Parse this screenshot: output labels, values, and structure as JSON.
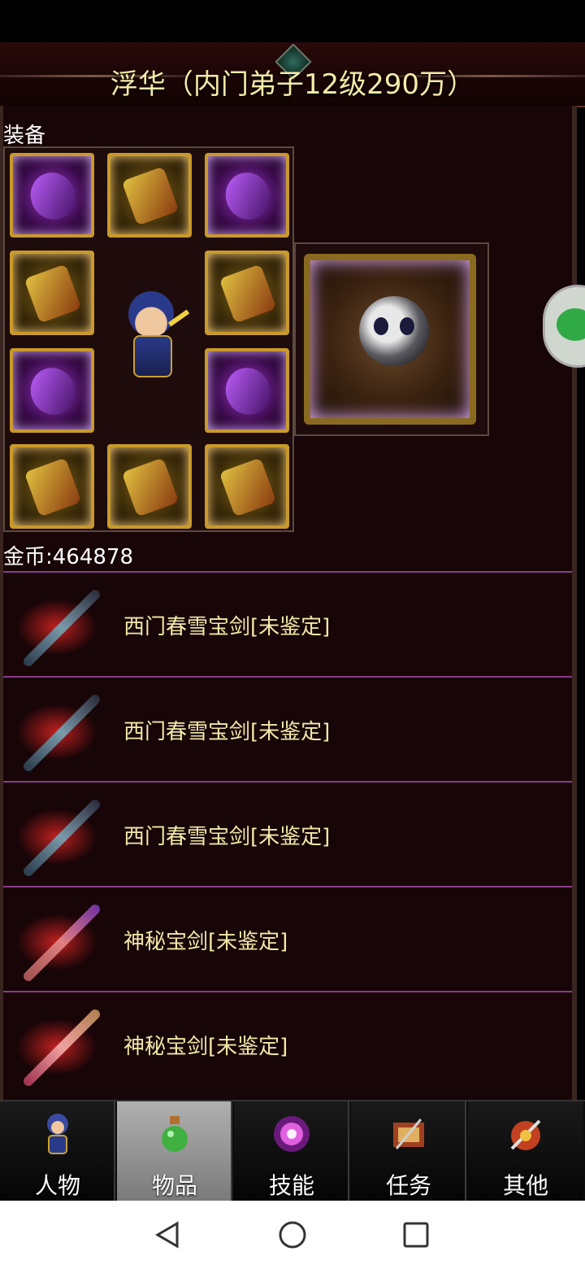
{
  "header": {
    "title": "浮华（内门弟子12级290万）"
  },
  "equipment": {
    "section_label": "装备",
    "slots": [
      {
        "icon": "helmet-icon",
        "style": "purple-frame"
      },
      {
        "icon": "wings-armor-icon",
        "style": "gold-frame"
      },
      {
        "icon": "necklace-icon",
        "style": "purple-frame"
      },
      {
        "icon": "sword-icon",
        "style": "gold-frame"
      },
      {
        "icon": "sword-icon",
        "style": "gold-frame"
      },
      {
        "icon": "gauntlet-icon",
        "style": "purple-frame"
      },
      {
        "icon": "gauntlet-icon",
        "style": "purple-frame"
      },
      {
        "icon": "boots-icon",
        "style": "gold-frame"
      },
      {
        "icon": "belt-icon",
        "style": "gold-frame"
      },
      {
        "icon": "ring-icon",
        "style": "gold-frame"
      }
    ]
  },
  "pet": {
    "icon": "panda-pet-icon"
  },
  "gold": {
    "label": "金币:464878"
  },
  "items": [
    {
      "name": "西门春雪宝剑[未鉴定]",
      "icon": "dark-sword-icon"
    },
    {
      "name": "西门春雪宝剑[未鉴定]",
      "icon": "dark-sword-icon"
    },
    {
      "name": "西门春雪宝剑[未鉴定]",
      "icon": "dark-sword-icon"
    },
    {
      "name": "神秘宝剑[未鉴定]",
      "icon": "violet-sword-icon"
    },
    {
      "name": "神秘宝剑[未鉴定]",
      "icon": "rose-sword-icon"
    }
  ],
  "nav": {
    "tabs": [
      {
        "label": "人物",
        "icon": "character-icon",
        "active": false
      },
      {
        "label": "物品",
        "icon": "potion-icon",
        "active": true
      },
      {
        "label": "技能",
        "icon": "skill-orb-icon",
        "active": false
      },
      {
        "label": "任务",
        "icon": "quest-icon",
        "active": false
      },
      {
        "label": "其他",
        "icon": "other-icon",
        "active": false
      }
    ]
  },
  "colors": {
    "title_text": "#f5eaa8",
    "item_text": "#f3e8a8",
    "divider": "#8a3a8a",
    "background": "#170507"
  }
}
